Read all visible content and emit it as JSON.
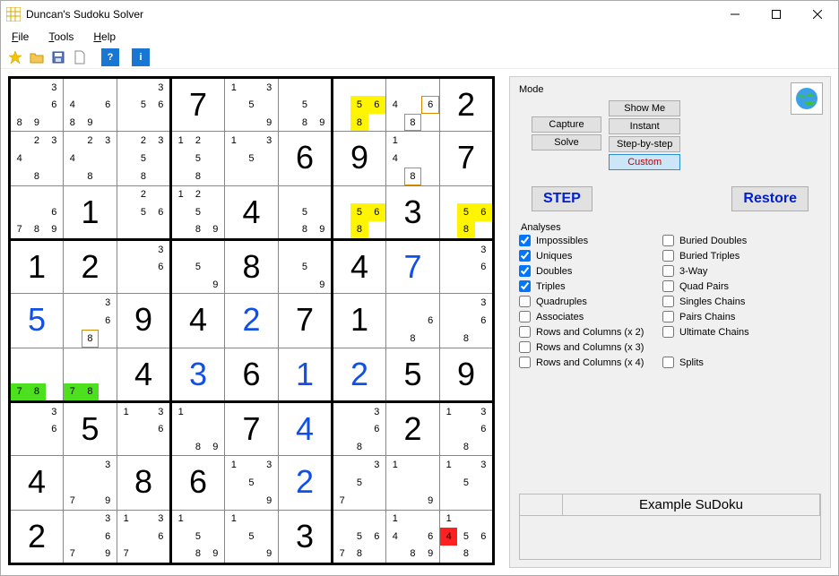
{
  "window": {
    "title": "Duncan's Sudoku Solver"
  },
  "menu": {
    "file": "File",
    "tools": "Tools",
    "help": "Help"
  },
  "toolbar": {
    "q": "?",
    "i": "i"
  },
  "side": {
    "mode_label": "Mode",
    "capture": "Capture",
    "solve": "Solve",
    "showme": "Show Me",
    "instant": "Instant",
    "stepbystep": "Step-by-step",
    "custom": "Custom",
    "step": "STEP",
    "restore": "Restore",
    "analyses_label": "Analyses",
    "analyses_left": [
      {
        "label": "Impossibles",
        "checked": true
      },
      {
        "label": "Uniques",
        "checked": true
      },
      {
        "label": "Doubles",
        "checked": true
      },
      {
        "label": "Triples",
        "checked": true
      },
      {
        "label": "Quadruples",
        "checked": false
      },
      {
        "label": "Associates",
        "checked": false
      },
      {
        "label": "Rows and Columns (x 2)",
        "checked": false
      },
      {
        "label": "Rows and Columns (x 3)",
        "checked": false
      },
      {
        "label": "Rows and Columns (x 4)",
        "checked": false
      }
    ],
    "analyses_right": [
      {
        "label": "Buried Doubles",
        "checked": false
      },
      {
        "label": "Buried Triples",
        "checked": false
      },
      {
        "label": "3-Way",
        "checked": false
      },
      {
        "label": "Quad Pairs",
        "checked": false
      },
      {
        "label": "Singles Chains",
        "checked": false
      },
      {
        "label": "Pairs Chains",
        "checked": false
      },
      {
        "label": "Ultimate Chains",
        "checked": false
      },
      {
        "label": "",
        "checked": null
      },
      {
        "label": "Splits",
        "checked": false
      }
    ],
    "example": "Example SuDoku"
  },
  "grid": [
    [
      {
        "t": "c",
        "c": [
          0,
          0,
          "3",
          0,
          0,
          "6",
          "8",
          "9",
          0
        ]
      },
      {
        "t": "c",
        "c": [
          0,
          0,
          0,
          "4",
          0,
          "6",
          "8",
          "9",
          0
        ]
      },
      {
        "t": "c",
        "c": [
          0,
          0,
          "3",
          0,
          "5",
          "6",
          0,
          0,
          0
        ]
      },
      {
        "t": "b",
        "v": "7"
      },
      {
        "t": "c",
        "c": [
          "1",
          0,
          "3",
          0,
          "5",
          0,
          0,
          0,
          "9"
        ]
      },
      {
        "t": "c",
        "c": [
          0,
          0,
          0,
          0,
          "5",
          0,
          0,
          "8",
          "9"
        ]
      },
      {
        "t": "c",
        "c": [
          0,
          0,
          0,
          0,
          {
            "v": "5",
            "hl": "y"
          },
          {
            "v": "6",
            "hl": "y"
          },
          0,
          {
            "v": "8",
            "hl": "y"
          },
          0
        ]
      },
      {
        "t": "c",
        "c": [
          0,
          0,
          0,
          "4",
          0,
          {
            "v": "6",
            "box": true
          },
          0,
          {
            "v": "8",
            "box": true
          },
          0
        ]
      },
      {
        "t": "b",
        "v": "2"
      }
    ],
    [
      {
        "t": "c",
        "c": [
          0,
          "2",
          "3",
          "4",
          0,
          0,
          0,
          "8",
          0
        ]
      },
      {
        "t": "c",
        "c": [
          0,
          "2",
          "3",
          "4",
          0,
          0,
          0,
          "8",
          0
        ]
      },
      {
        "t": "c",
        "c": [
          0,
          "2",
          "3",
          0,
          "5",
          0,
          0,
          "8",
          0
        ]
      },
      {
        "t": "c",
        "c": [
          "1",
          "2",
          0,
          0,
          "5",
          0,
          0,
          "8",
          0
        ]
      },
      {
        "t": "c",
        "c": [
          "1",
          0,
          "3",
          0,
          "5",
          0,
          0,
          0,
          0
        ]
      },
      {
        "t": "b",
        "v": "6"
      },
      {
        "t": "b",
        "v": "9"
      },
      {
        "t": "c",
        "c": [
          "1",
          0,
          0,
          "4",
          0,
          0,
          0,
          {
            "v": "8",
            "box": true
          },
          0
        ]
      },
      {
        "t": "b",
        "v": "7"
      }
    ],
    [
      {
        "t": "c",
        "c": [
          0,
          0,
          0,
          0,
          0,
          "6",
          "7",
          "8",
          "9"
        ]
      },
      {
        "t": "b",
        "v": "1"
      },
      {
        "t": "c",
        "c": [
          0,
          "2",
          0,
          0,
          "5",
          "6",
          0,
          0,
          0
        ]
      },
      {
        "t": "c",
        "c": [
          "1",
          "2",
          0,
          0,
          "5",
          0,
          0,
          "8",
          "9"
        ]
      },
      {
        "t": "b",
        "v": "4"
      },
      {
        "t": "c",
        "c": [
          0,
          0,
          0,
          0,
          "5",
          0,
          0,
          "8",
          "9"
        ]
      },
      {
        "t": "c",
        "c": [
          0,
          0,
          0,
          0,
          {
            "v": "5",
            "hl": "y"
          },
          {
            "v": "6",
            "hl": "y"
          },
          0,
          {
            "v": "8",
            "hl": "y"
          },
          0
        ]
      },
      {
        "t": "b",
        "v": "3"
      },
      {
        "t": "c",
        "c": [
          0,
          0,
          0,
          0,
          {
            "v": "5",
            "hl": "y"
          },
          {
            "v": "6",
            "hl": "y"
          },
          0,
          {
            "v": "8",
            "hl": "y"
          },
          0
        ]
      }
    ],
    [
      {
        "t": "b",
        "v": "1"
      },
      {
        "t": "b",
        "v": "2"
      },
      {
        "t": "c",
        "c": [
          0,
          0,
          "3",
          0,
          0,
          "6",
          0,
          0,
          0
        ]
      },
      {
        "t": "c",
        "c": [
          0,
          0,
          0,
          0,
          "5",
          0,
          0,
          0,
          "9"
        ]
      },
      {
        "t": "b",
        "v": "8"
      },
      {
        "t": "c",
        "c": [
          0,
          0,
          0,
          0,
          "5",
          0,
          0,
          0,
          "9"
        ]
      },
      {
        "t": "b",
        "v": "4"
      },
      {
        "t": "b",
        "v": "7",
        "cls": "blue"
      },
      {
        "t": "c",
        "c": [
          0,
          0,
          "3",
          0,
          0,
          "6",
          0,
          0,
          0
        ]
      }
    ],
    [
      {
        "t": "b",
        "v": "5",
        "cls": "blue"
      },
      {
        "t": "c",
        "c": [
          0,
          0,
          "3",
          0,
          0,
          "6",
          0,
          {
            "v": "8",
            "box": true
          },
          0
        ]
      },
      {
        "t": "b",
        "v": "9"
      },
      {
        "t": "b",
        "v": "4"
      },
      {
        "t": "b",
        "v": "2",
        "cls": "blue"
      },
      {
        "t": "b",
        "v": "7"
      },
      {
        "t": "b",
        "v": "1"
      },
      {
        "t": "c",
        "c": [
          0,
          0,
          0,
          0,
          0,
          "6",
          0,
          "8",
          0
        ]
      },
      {
        "t": "c",
        "c": [
          0,
          0,
          "3",
          0,
          0,
          "6",
          0,
          "8",
          0
        ]
      }
    ],
    [
      {
        "t": "c",
        "c": [
          0,
          0,
          0,
          0,
          0,
          0,
          {
            "v": "7",
            "hl": "g"
          },
          {
            "v": "8",
            "hl": "g"
          },
          0
        ]
      },
      {
        "t": "c",
        "c": [
          0,
          0,
          0,
          0,
          0,
          0,
          {
            "v": "7",
            "hl": "g"
          },
          {
            "v": "8",
            "hl": "g"
          },
          0
        ]
      },
      {
        "t": "b",
        "v": "4"
      },
      {
        "t": "b",
        "v": "3",
        "cls": "blue"
      },
      {
        "t": "b",
        "v": "6"
      },
      {
        "t": "b",
        "v": "1",
        "cls": "blue"
      },
      {
        "t": "b",
        "v": "2",
        "cls": "blue"
      },
      {
        "t": "b",
        "v": "5"
      },
      {
        "t": "b",
        "v": "9"
      }
    ],
    [
      {
        "t": "c",
        "c": [
          0,
          0,
          "3",
          0,
          0,
          "6",
          0,
          0,
          0
        ]
      },
      {
        "t": "b",
        "v": "5"
      },
      {
        "t": "c",
        "c": [
          "1",
          0,
          "3",
          0,
          0,
          "6",
          0,
          0,
          0
        ]
      },
      {
        "t": "c",
        "c": [
          "1",
          0,
          0,
          0,
          0,
          0,
          0,
          "8",
          "9"
        ]
      },
      {
        "t": "b",
        "v": "7"
      },
      {
        "t": "b",
        "v": "4",
        "cls": "blue"
      },
      {
        "t": "c",
        "c": [
          0,
          0,
          "3",
          0,
          0,
          "6",
          0,
          "8",
          0
        ]
      },
      {
        "t": "b",
        "v": "2"
      },
      {
        "t": "c",
        "c": [
          "1",
          0,
          "3",
          0,
          0,
          "6",
          0,
          "8",
          0
        ]
      }
    ],
    [
      {
        "t": "b",
        "v": "4"
      },
      {
        "t": "c",
        "c": [
          0,
          0,
          "3",
          0,
          0,
          0,
          "7",
          0,
          "9"
        ]
      },
      {
        "t": "b",
        "v": "8"
      },
      {
        "t": "b",
        "v": "6"
      },
      {
        "t": "c",
        "c": [
          "1",
          0,
          "3",
          0,
          "5",
          0,
          0,
          0,
          "9"
        ]
      },
      {
        "t": "b",
        "v": "2",
        "cls": "blue"
      },
      {
        "t": "c",
        "c": [
          0,
          0,
          "3",
          0,
          "5",
          0,
          "7",
          0,
          0
        ]
      },
      {
        "t": "c",
        "c": [
          "1",
          0,
          0,
          0,
          0,
          0,
          0,
          0,
          "9"
        ]
      },
      {
        "t": "c",
        "c": [
          "1",
          0,
          "3",
          0,
          "5",
          0,
          0,
          0,
          0
        ]
      }
    ],
    [
      {
        "t": "b",
        "v": "2"
      },
      {
        "t": "c",
        "c": [
          0,
          0,
          "3",
          0,
          0,
          "6",
          "7",
          0,
          "9"
        ]
      },
      {
        "t": "c",
        "c": [
          "1",
          0,
          "3",
          0,
          0,
          "6",
          "7",
          0,
          0
        ]
      },
      {
        "t": "c",
        "c": [
          "1",
          0,
          0,
          0,
          "5",
          0,
          0,
          "8",
          "9"
        ]
      },
      {
        "t": "c",
        "c": [
          "1",
          0,
          0,
          0,
          "5",
          0,
          0,
          0,
          "9"
        ]
      },
      {
        "t": "b",
        "v": "3"
      },
      {
        "t": "c",
        "c": [
          0,
          0,
          0,
          0,
          "5",
          "6",
          "7",
          "8",
          0
        ]
      },
      {
        "t": "c",
        "c": [
          "1",
          0,
          0,
          "4",
          0,
          "6",
          0,
          "8",
          "9"
        ]
      },
      {
        "t": "c",
        "c": [
          "1",
          0,
          0,
          {
            "v": "4",
            "hl": "r"
          },
          "5",
          "6",
          0,
          "8",
          0
        ]
      }
    ]
  ]
}
